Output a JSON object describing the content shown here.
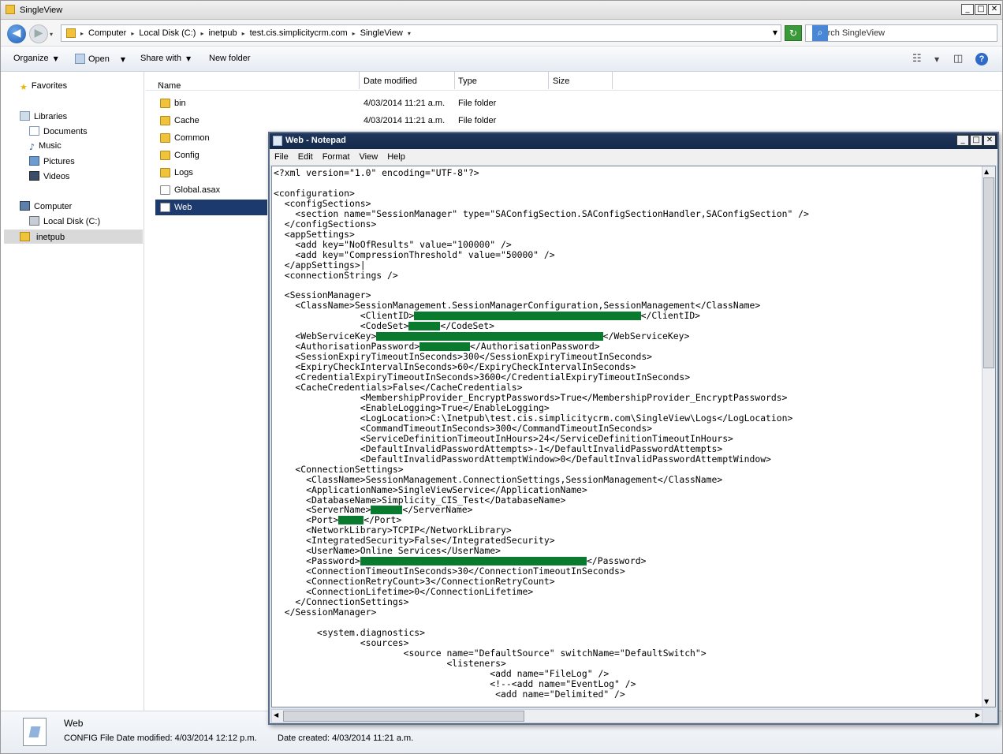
{
  "explorer": {
    "title": "SingleView",
    "breadcrumbs": [
      "Computer",
      "Local Disk (C:)",
      "inetpub",
      "test.cis.simplicitycrm.com",
      "SingleView"
    ],
    "search_placeholder": "Search SingleView",
    "toolbar": {
      "organize": "Organize",
      "open": "Open",
      "share": "Share with",
      "new_folder": "New folder"
    },
    "nav": {
      "favorites": "Favorites",
      "libraries": "Libraries",
      "documents": "Documents",
      "music": "Music",
      "pictures": "Pictures",
      "videos": "Videos",
      "computer": "Computer",
      "local_disk": "Local Disk (C:)",
      "inetpub": "inetpub"
    },
    "columns": {
      "name": "Name",
      "date": "Date modified",
      "type": "Type",
      "size": "Size"
    },
    "files": [
      {
        "name": "bin",
        "date": "4/03/2014 11:21 a.m.",
        "type": "File folder"
      },
      {
        "name": "Cache",
        "date": "4/03/2014 11:21 a.m.",
        "type": "File folder"
      },
      {
        "name": "Common"
      },
      {
        "name": "Config"
      },
      {
        "name": "Logs"
      },
      {
        "name": "Global.asax"
      },
      {
        "name": "Web"
      }
    ],
    "details": {
      "name": "Web",
      "type_line": "CONFIG File Date modified: 4/03/2014 12:12 p.m.",
      "created": "Date created: 4/03/2014 11:21 a.m."
    }
  },
  "notepad": {
    "title": "Web - Notepad",
    "menu": [
      "File",
      "Edit",
      "Format",
      "View",
      "Help"
    ],
    "lines": [
      {
        "t": "<?xml version=\"1.0\" encoding=\"UTF-8\"?>"
      },
      {
        "t": ""
      },
      {
        "t": "<configuration>"
      },
      {
        "t": "  <configSections>"
      },
      {
        "t": "    <section name=\"SessionManager\" type=\"SAConfigSection.SAConfigSectionHandler,SAConfigSection\" />"
      },
      {
        "t": "  </configSections>"
      },
      {
        "t": "  <appSettings>"
      },
      {
        "t": "    <add key=\"NoOfResults\" value=\"100000\" />"
      },
      {
        "t": "    <add key=\"CompressionThreshold\" value=\"50000\" />"
      },
      {
        "t": "  </appSettings>|"
      },
      {
        "t": "  <connectionStrings />"
      },
      {
        "t": ""
      },
      {
        "t": "  <SessionManager>"
      },
      {
        "t": "    <ClassName>SessionManagement.SessionManagerConfiguration,SessionManagement</ClassName>"
      },
      {
        "t": "                <ClientID>",
        "r": 36,
        "t2": "</ClientID>"
      },
      {
        "t": "                <CodeSet>",
        "r": 5,
        "t2": "</CodeSet>"
      },
      {
        "t": "    <WebServiceKey>",
        "r": 36,
        "t2": "</WebServiceKey>"
      },
      {
        "t": "    <AuthorisationPassword>",
        "r": 8,
        "t2": "</AuthorisationPassword>"
      },
      {
        "t": "    <SessionExpiryTimeoutInSeconds>300</SessionExpiryTimeoutInSeconds>"
      },
      {
        "t": "    <ExpiryCheckIntervalInSeconds>60</ExpiryCheckIntervalInSeconds>"
      },
      {
        "t": "    <CredentialExpiryTimeoutInSeconds>3600</CredentialExpiryTimeoutInSeconds>"
      },
      {
        "t": "    <CacheCredentials>False</CacheCredentials>"
      },
      {
        "t": "                <MembershipProvider_EncryptPasswords>True</MembershipProvider_EncryptPasswords>"
      },
      {
        "t": "                <EnableLogging>True</EnableLogging>"
      },
      {
        "t": "                <LogLocation>C:\\Inetpub\\test.cis.simplicitycrm.com\\SingleView\\Logs</LogLocation>"
      },
      {
        "t": "                <CommandTimeoutInSeconds>300</CommandTimeoutInSeconds>"
      },
      {
        "t": "                <ServiceDefinitionTimeoutInHours>24</ServiceDefinitionTimeoutInHours>"
      },
      {
        "t": "                <DefaultInvalidPasswordAttempts>-1</DefaultInvalidPasswordAttempts>"
      },
      {
        "t": "                <DefaultInvalidPasswordAttemptWindow>0</DefaultInvalidPasswordAttemptWindow>"
      },
      {
        "t": "    <ConnectionSettings>"
      },
      {
        "t": "      <ClassName>SessionManagement.ConnectionSettings,SessionManagement</ClassName>"
      },
      {
        "t": "      <ApplicationName>SingleViewService</ApplicationName>"
      },
      {
        "t": "      <DatabaseName>Simplicity_CIS_Test</DatabaseName>"
      },
      {
        "t": "      <ServerName>",
        "r": 5,
        "t2": "</ServerName>"
      },
      {
        "t": "      <Port>",
        "r": 4,
        "t2": "</Port>"
      },
      {
        "t": "      <NetworkLibrary>TCPIP</NetworkLibrary>"
      },
      {
        "t": "      <IntegratedSecurity>False</IntegratedSecurity>"
      },
      {
        "t": "      <UserName>Online Services</UserName>"
      },
      {
        "t": "      <Password>",
        "r": 36,
        "t2": "</Password>"
      },
      {
        "t": "      <ConnectionTimeoutInSeconds>30</ConnectionTimeoutInSeconds>"
      },
      {
        "t": "      <ConnectionRetryCount>3</ConnectionRetryCount>"
      },
      {
        "t": "      <ConnectionLifetime>0</ConnectionLifetime>"
      },
      {
        "t": "    </ConnectionSettings>"
      },
      {
        "t": "  </SessionManager>"
      },
      {
        "t": ""
      },
      {
        "t": "        <system.diagnostics>"
      },
      {
        "t": "                <sources>"
      },
      {
        "t": "                        <source name=\"DefaultSource\" switchName=\"DefaultSwitch\">"
      },
      {
        "t": "                                <listeners>"
      },
      {
        "t": "                                        <add name=\"FileLog\" />"
      },
      {
        "t": "                                        <!--<add name=\"EventLog\" />"
      },
      {
        "t": "                                         <add name=\"Delimited\" />"
      }
    ]
  }
}
